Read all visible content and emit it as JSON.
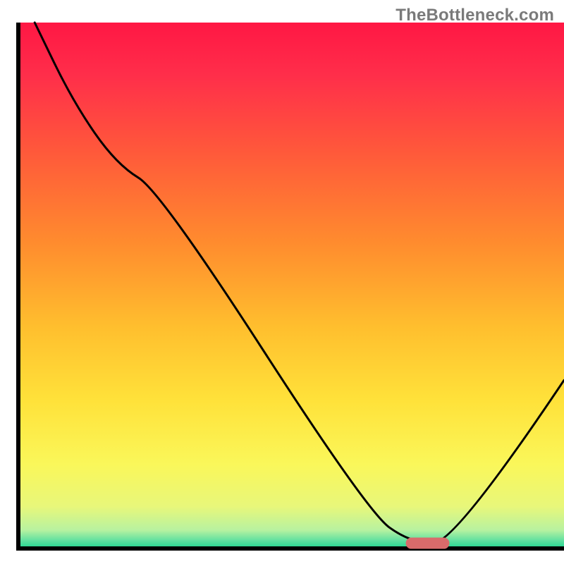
{
  "watermark": "TheBottleneck.com",
  "chart_data": {
    "type": "line",
    "title": "",
    "xlabel": "",
    "ylabel": "",
    "xlim": [
      0,
      100
    ],
    "ylim": [
      0,
      100
    ],
    "series": [
      {
        "name": "bottleneck-curve",
        "x": [
          3,
          10,
          18,
          26,
          64,
          72,
          80,
          100
        ],
        "values": [
          100,
          85,
          73,
          68,
          7,
          1,
          1,
          32
        ]
      }
    ],
    "marker": {
      "name": "target-range",
      "x_center": 75,
      "y": 1,
      "width": 8,
      "color": "#d96b6b"
    },
    "gradient_stops": [
      {
        "offset": 0.0,
        "color": "#ff1744"
      },
      {
        "offset": 0.1,
        "color": "#ff2e4a"
      },
      {
        "offset": 0.25,
        "color": "#ff5a3a"
      },
      {
        "offset": 0.42,
        "color": "#ff8c2e"
      },
      {
        "offset": 0.58,
        "color": "#ffbf2e"
      },
      {
        "offset": 0.72,
        "color": "#ffe23a"
      },
      {
        "offset": 0.84,
        "color": "#faf75a"
      },
      {
        "offset": 0.92,
        "color": "#e8f77a"
      },
      {
        "offset": 0.965,
        "color": "#b8f2a0"
      },
      {
        "offset": 0.985,
        "color": "#5fe0a0"
      },
      {
        "offset": 1.0,
        "color": "#1ed690"
      }
    ]
  }
}
